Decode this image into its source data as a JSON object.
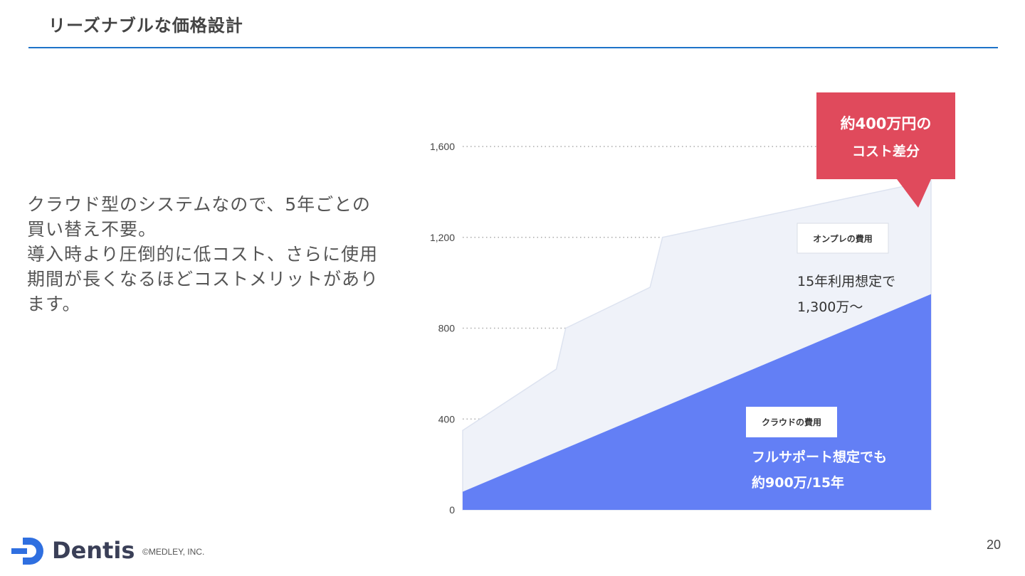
{
  "slide": {
    "title": "リーズナブルな価格設計",
    "body_lines": [
      "クラウド型のシステムなので、5年ごとの買い替え不要。",
      "導入時より圧倒的に低コスト、さらに使用期間が長くなるほどコストメリットがあります。"
    ],
    "page_number": "20"
  },
  "footer": {
    "brand": "Dentis",
    "copyright": "©MEDLEY, INC."
  },
  "colors": {
    "accent_rule": "#1e73c8",
    "cloud_fill": "#637ff5",
    "onprem_fill": "#eff2f9",
    "callout_fill": "#e04a5c",
    "logo": "#2f6fe0"
  },
  "chart_data": {
    "type": "area",
    "ylim": [
      0,
      1600
    ],
    "yticks": [
      0,
      400,
      800,
      1200,
      1600
    ],
    "ytick_labels": [
      "0",
      "400",
      "800",
      "1,200",
      "1,600"
    ],
    "xlabel": "",
    "ylabel": "",
    "x_range": [
      0,
      15
    ],
    "grid": "horizontal dotted",
    "series": [
      {
        "name": "オンプレの費用",
        "points": [
          [
            0,
            350
          ],
          [
            3,
            620
          ],
          [
            3.3,
            800
          ],
          [
            6,
            980
          ],
          [
            6.4,
            1200
          ],
          [
            15,
            1450
          ]
        ]
      },
      {
        "name": "クラウドの費用",
        "points": [
          [
            0,
            80
          ],
          [
            15,
            950
          ]
        ]
      }
    ],
    "annotations": {
      "onprem_label": "オンプレの費用",
      "onprem_note_line1": "15年利用想定で",
      "onprem_note_line2": "1,300万〜",
      "cloud_label": "クラウドの費用",
      "cloud_note_line1": "フルサポート想定でも",
      "cloud_note_line2": "約900万/15年",
      "callout_line1": "約400万円の",
      "callout_line2": "コスト差分"
    }
  }
}
